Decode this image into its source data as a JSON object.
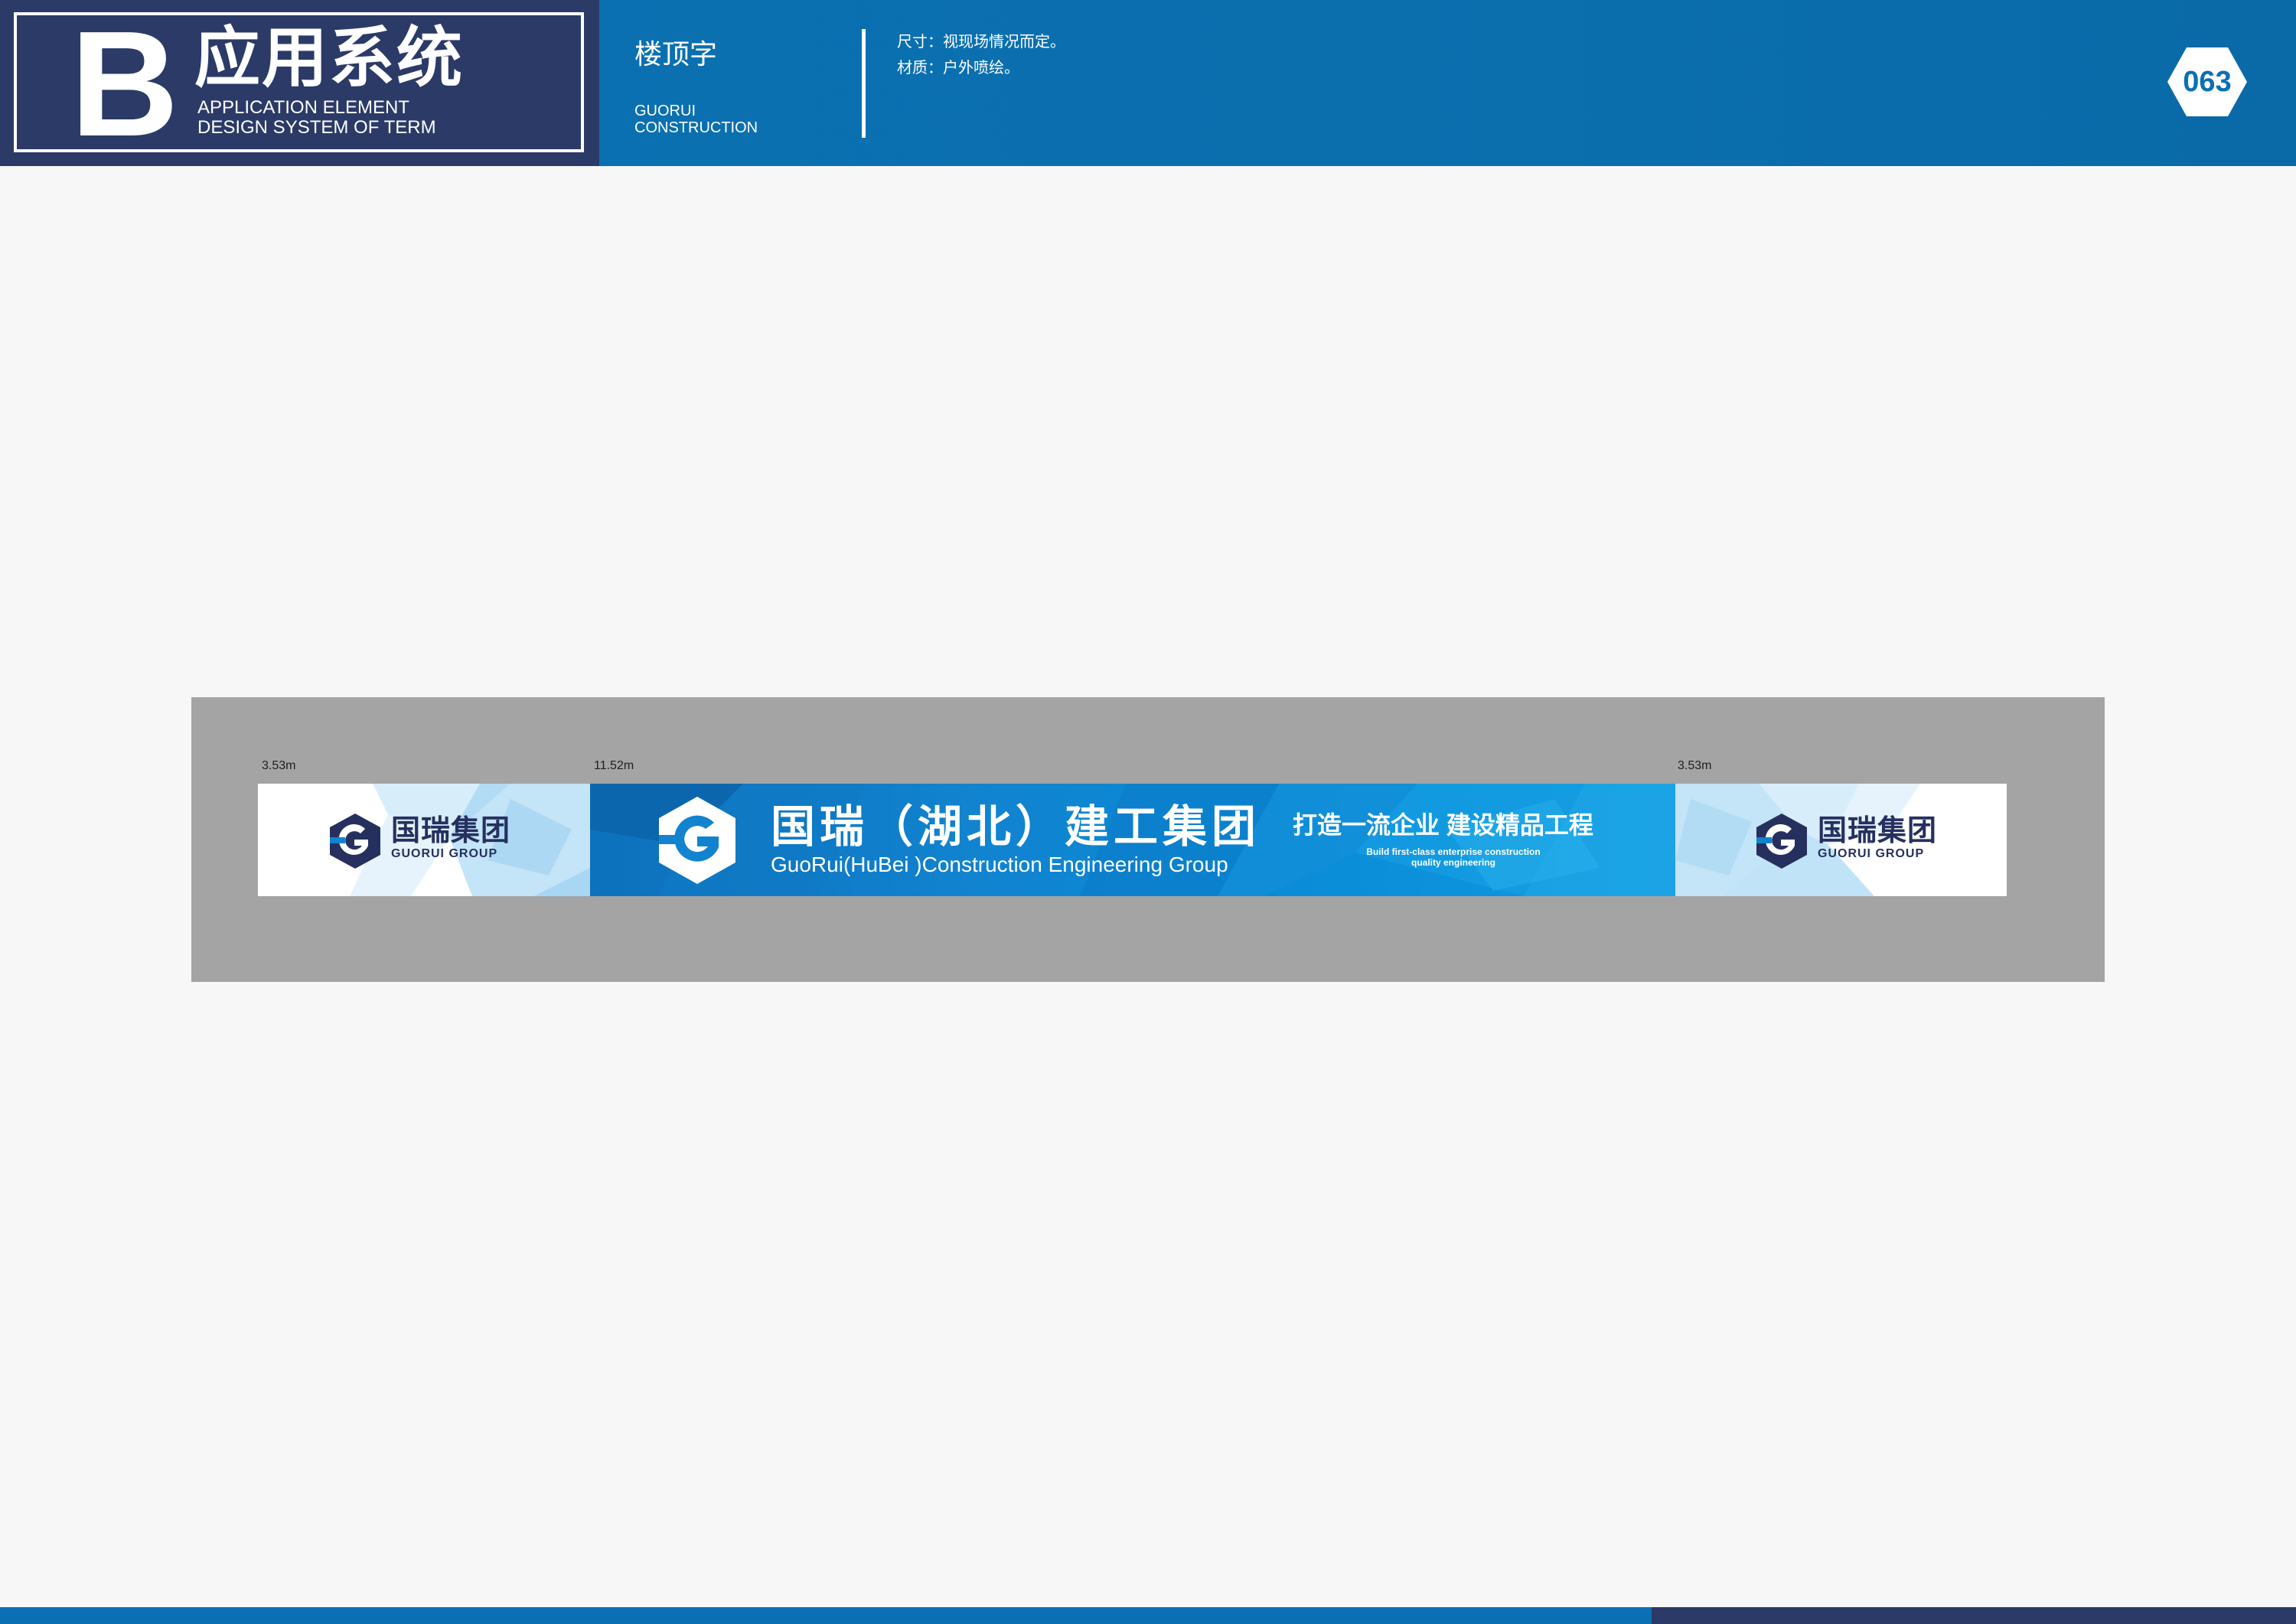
{
  "header": {
    "brand_letter": "B",
    "brand_title": "应用系统",
    "brand_sub_line1": "APPLICATION ELEMENT",
    "brand_sub_line2": "DESIGN SYSTEM OF TERM",
    "section_title": "楼顶字",
    "section_sub_line1": "GUORUI",
    "section_sub_line2": "CONSTRUCTION",
    "spec_size": "尺寸：视现场情况而定。",
    "spec_material": "材质：户外喷绘。",
    "page_number": "063"
  },
  "sign": {
    "dim_left": "3.53m",
    "dim_center": "11.52m",
    "dim_right": "3.53m",
    "side_logo_name": "国瑞集团",
    "side_logo_sub": "GUORUI GROUP",
    "center_name": "国瑞（湖北）建工集团",
    "center_name_en": "GuoRui(HuBei )Construction Engineering Group",
    "slogan": "打造一流企业  建设精品工程",
    "slogan_en_line1": "Build first-class enterprise construction",
    "slogan_en_line2": "quality engineering"
  },
  "colors": {
    "header_blue": "#0a70b3",
    "brand_navy": "#2b3a67",
    "banner_blue": "#1183cf",
    "panel_gray": "#a4a4a4"
  },
  "icons": {
    "logo_mark": "hexagon-g-logo-icon",
    "page_badge": "hexagon-badge-icon"
  }
}
